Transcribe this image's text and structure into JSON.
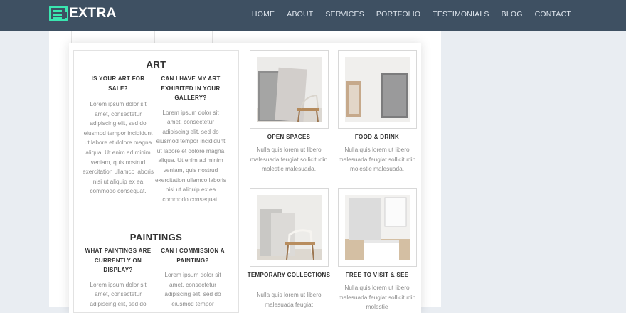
{
  "header": {
    "logo_text": "EXTRA",
    "nav": [
      "HOME",
      "ABOUT",
      "SERVICES",
      "PORTFOLIO",
      "TESTIMONIALS",
      "BLOG",
      "CONTACT"
    ]
  },
  "colors": {
    "header_bg": "#3e5062",
    "logo_accent": "#3ae6b0",
    "page_bg": "#e9edf2"
  },
  "art": {
    "title": "ART",
    "q1": {
      "question": "IS YOUR ART FOR SALE?",
      "answer": "Lorem ipsum dolor sit amet, consectetur adipiscing elit, sed do eiusmod tempor incididunt ut labore et dolore magna aliqua. Ut enim ad minim veniam, quis nostrud exercitation ullamco laboris nisi ut aliquip ex ea commodo consequat."
    },
    "q2": {
      "question": "CAN I HAVE MY ART EXHIBITED IN YOUR GALLERY?",
      "answer": "Lorem ipsum dolor sit amet, consectetur adipiscing elit, sed do eiusmod tempor incididunt ut labore et dolore magna aliqua. Ut enim ad minim veniam, quis nostrud exercitation ullamco laboris nisi ut aliquip ex ea commodo consequat."
    }
  },
  "paintings": {
    "title": "PAINTINGS",
    "q1": {
      "question": "WHAT PAINTINGS ARE CURRENTLY ON DISPLAY?",
      "answer": "Lorem ipsum dolor sit amet, consectetur adipiscing elit, sed do"
    },
    "q2": {
      "question": "CAN I COMMISSION A PAINTING?",
      "answer": "Lorem ipsum dolor sit amet, consectetur adipiscing elit, sed do eiusmod tempor"
    }
  },
  "features": [
    {
      "title": "OPEN SPACES",
      "desc": "Nulla quis lorem ut libero malesuada feugiat sollicitudin molestie malesuada."
    },
    {
      "title": "FOOD & DRINK",
      "desc": "Nulla quis lorem ut libero malesuada feugiat sollicitudin molestie malesuada."
    },
    {
      "title": "TEMPORARY COLLECTIONS",
      "desc": "Nulla quis lorem ut libero malesuada feugiat"
    },
    {
      "title": "FREE TO VISIT & SEE",
      "desc": "Nulla quis lorem ut libero malesuada feugiat sollicitudin molestie"
    }
  ]
}
